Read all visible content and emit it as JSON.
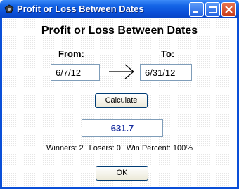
{
  "window": {
    "title": "Profit or Loss Between Dates"
  },
  "dialog": {
    "heading": "Profit or Loss Between Dates",
    "from_label": "From:",
    "to_label": "To:",
    "from_value": "6/7/12",
    "to_value": "6/31/12",
    "calculate_label": "Calculate",
    "result_value": "631.7",
    "winners": "Winners: 2",
    "losers": "Losers: 0",
    "win_percent": "Win Percent: 100%",
    "ok_label": "OK"
  },
  "colors": {
    "titlebar": "#0a4fd8",
    "result_text": "#1a2fa0"
  }
}
